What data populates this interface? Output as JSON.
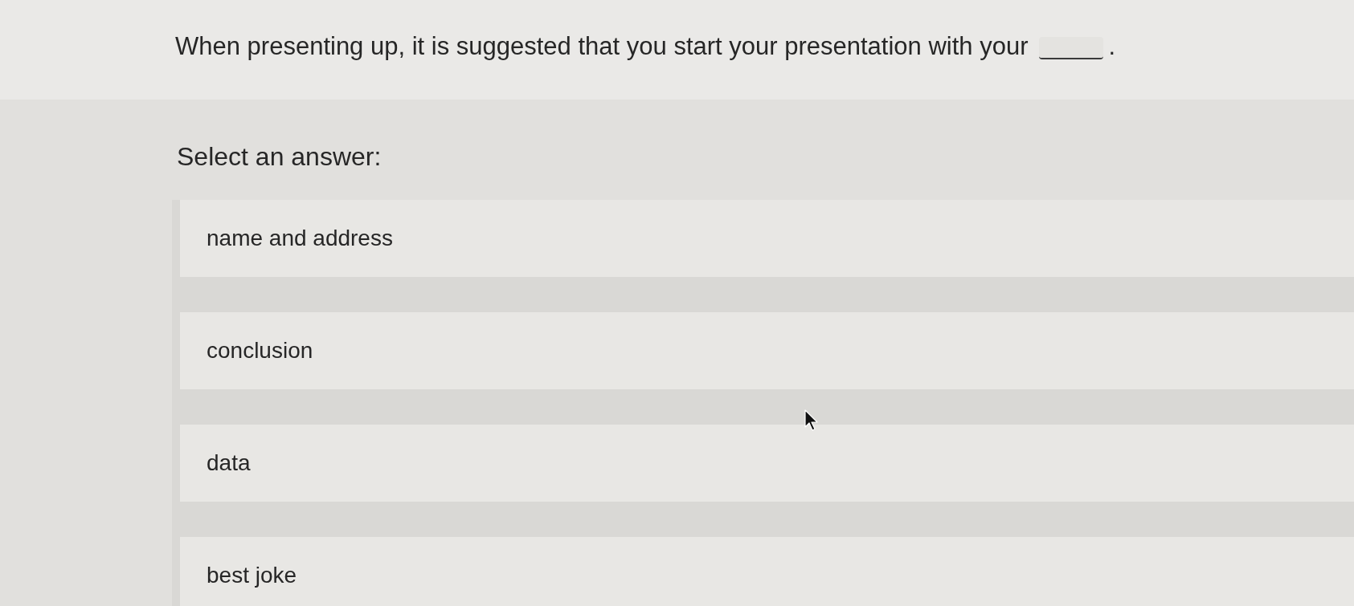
{
  "question": {
    "parts": [
      {
        "kind": "text",
        "text": "When presenting up, it is suggested that you start your presentation with your"
      },
      {
        "kind": "blank"
      },
      {
        "kind": "text",
        "text": "."
      }
    ]
  },
  "prompt": "Select an answer:",
  "options": [
    {
      "label": "name and address",
      "selected": false
    },
    {
      "label": "conclusion",
      "selected": false
    },
    {
      "label": "data",
      "selected": false
    },
    {
      "label": "best joke",
      "selected": false
    }
  ]
}
